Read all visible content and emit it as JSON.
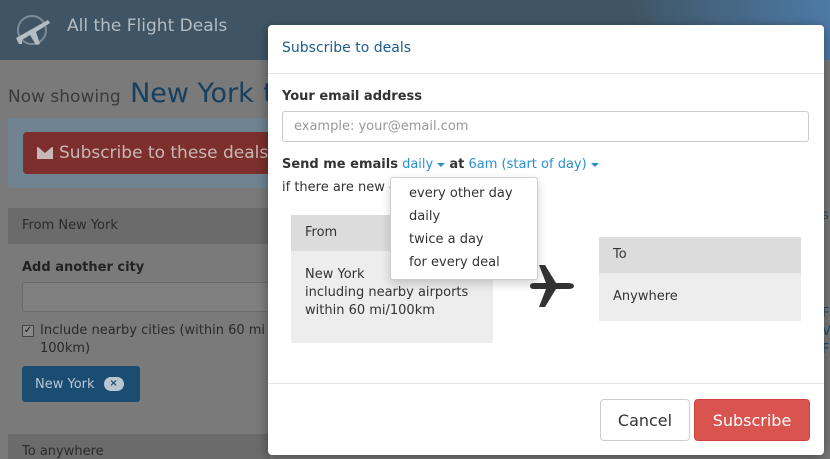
{
  "header": {
    "site_title": "All the Flight Deals",
    "logo_icon": "plane-logo-icon"
  },
  "page": {
    "now_showing_prefix": "Now showing",
    "city": "New York",
    "city_trailing": "t",
    "subscribe_button": "Subscribe to these deals",
    "from_panel_title": "From New York",
    "add_city_label": "Add another city",
    "nearby_label_line1": "Include nearby cities (within 60 mi",
    "nearby_label_line2": "100km)",
    "city_tag": "New York",
    "city_tag_remove": "×",
    "to_panel_title": "To anywhere",
    "right_fragments": [
      "s",
      "F",
      "V",
      "F"
    ]
  },
  "modal": {
    "title": "Subscribe to deals",
    "email_label": "Your email address",
    "email_placeholder": "example: your@email.com",
    "email_value": "",
    "send_prefix": "Send me emails",
    "frequency": "daily",
    "at_word": "at",
    "time": "6am (start of day)",
    "new_row_prefix": "if there are new",
    "new_row_fragment": "c",
    "from_box": {
      "head": "From",
      "lines": [
        "New York",
        "including nearby airports",
        "within 60 mi/100km"
      ]
    },
    "plane_icon": "plane-icon",
    "to_box": {
      "head": "To",
      "destination": "Anywhere"
    },
    "cancel_label": "Cancel",
    "subscribe_label": "Subscribe"
  },
  "dropdown": {
    "options": [
      "every other day",
      "daily",
      "twice a day",
      "for every deal"
    ]
  },
  "colors": {
    "header_bg": "#3f5565",
    "link_blue": "#2a8fcf",
    "title_blue": "#1e5c8a",
    "subscribe_red": "#d9534f",
    "tag_blue": "#1b4d73"
  }
}
